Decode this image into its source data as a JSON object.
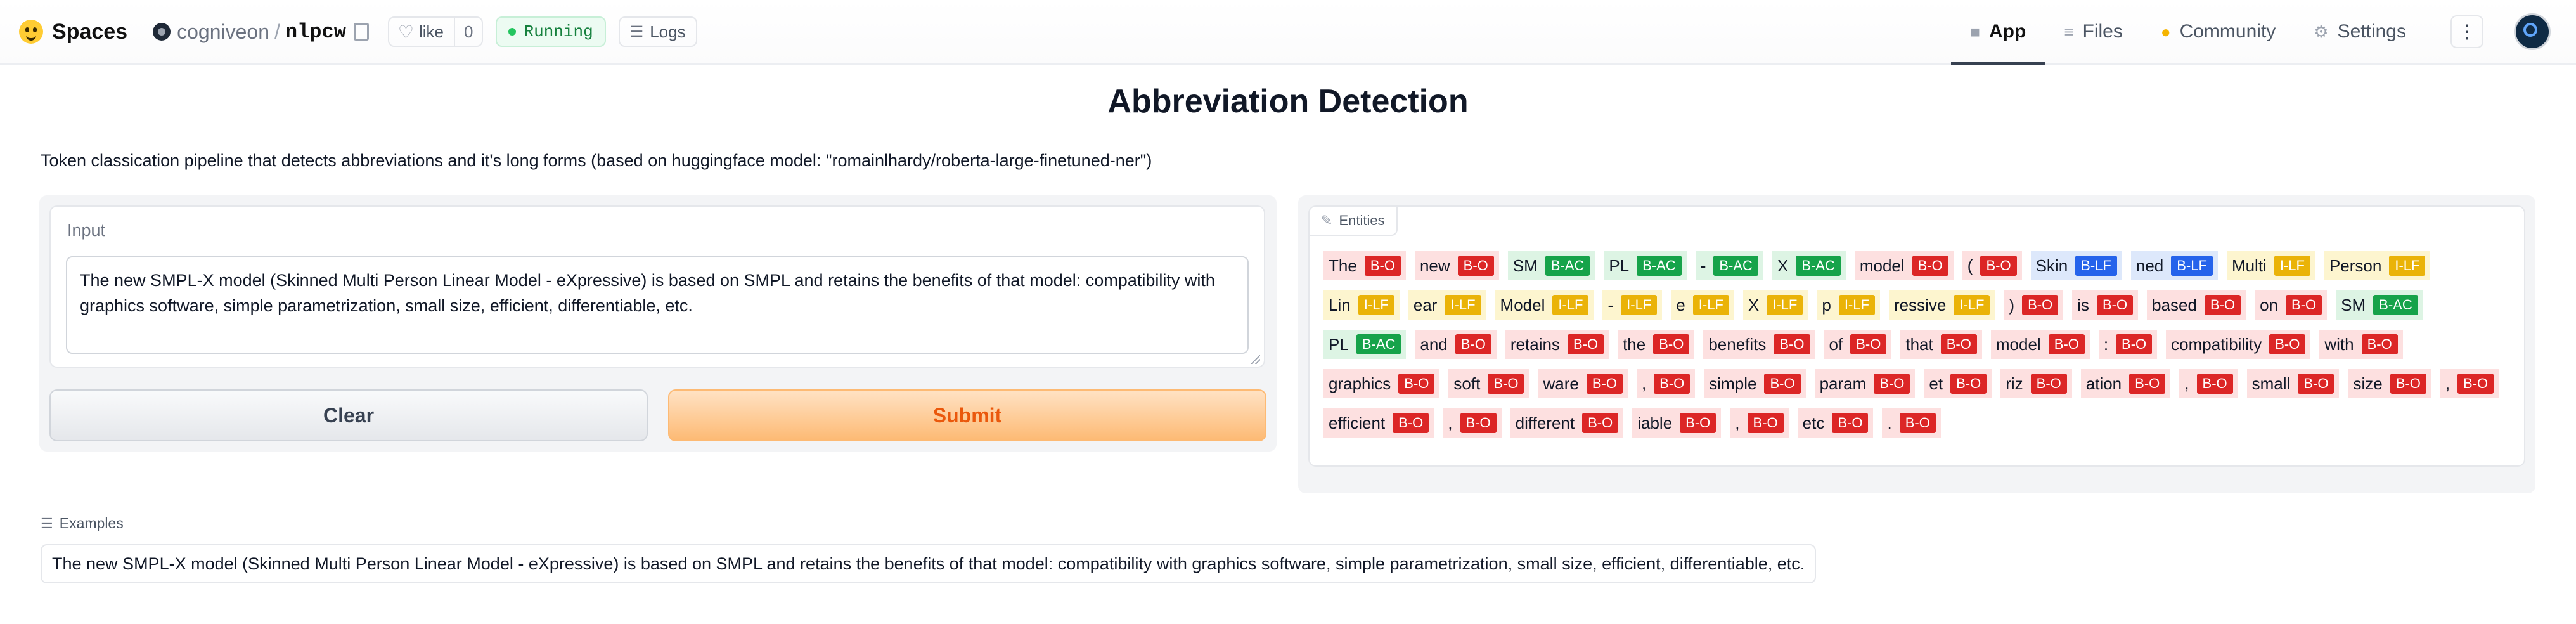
{
  "header": {
    "brand": "Spaces",
    "owner": "cogniveon",
    "separator": "/",
    "repo": "nlpcw",
    "like_label": "like",
    "like_count": "0",
    "status": "Running",
    "logs_label": "Logs",
    "tabs": [
      {
        "label": "App",
        "icon": "app-cube-icon",
        "active": true
      },
      {
        "label": "Files",
        "icon": "files-icon",
        "active": false
      },
      {
        "label": "Community",
        "icon": "community-chat-icon",
        "active": false
      },
      {
        "label": "Settings",
        "icon": "settings-gear-icon",
        "active": false
      }
    ],
    "more_icon": "vertical-dots-icon"
  },
  "main": {
    "title": "Abbreviation Detection",
    "description": "Token classication pipeline that detects abbreviations and it's long forms (based on huggingface model: \"romainlhardy/roberta-large-finetuned-ner\")",
    "input_label": "Input",
    "input_value": "The new SMPL-X model (Skinned Multi Person Linear Model - eXpressive) is based on SMPL and retains the benefits of that model: compatibility with graphics software, simple parametrization, small size, efficient, differentiable, etc.",
    "clear_label": "Clear",
    "submit_label": "Submit",
    "entities_label": "Entities",
    "examples_label": "Examples",
    "example_1": "The new SMPL-X model (Skinned Multi Person Linear Model - eXpressive) is based on SMPL and retains the benefits of that model: compatibility with graphics software, simple parametrization, small size, efficient, differentiable, etc."
  },
  "entity_colors": {
    "B-O": "#dc2626",
    "B-AC": "#16a34a",
    "B-LF": "#2563eb",
    "I-LF": "#eab308"
  },
  "tokens": [
    {
      "text": "The",
      "tag": "B-O"
    },
    {
      "text": "new",
      "tag": "B-O"
    },
    {
      "text": "SM",
      "tag": "B-AC"
    },
    {
      "text": "PL",
      "tag": "B-AC"
    },
    {
      "text": "-",
      "tag": "B-AC"
    },
    {
      "text": "X",
      "tag": "B-AC"
    },
    {
      "text": "model",
      "tag": "B-O"
    },
    {
      "text": "(",
      "tag": "B-O"
    },
    {
      "text": "Skin",
      "tag": "B-LF"
    },
    {
      "text": "ned",
      "tag": "B-LF"
    },
    {
      "text": "Multi",
      "tag": "I-LF"
    },
    {
      "text": "Person",
      "tag": "I-LF"
    },
    {
      "text": "Lin",
      "tag": "I-LF"
    },
    {
      "text": "ear",
      "tag": "I-LF"
    },
    {
      "text": "Model",
      "tag": "I-LF"
    },
    {
      "text": "-",
      "tag": "I-LF"
    },
    {
      "text": "e",
      "tag": "I-LF"
    },
    {
      "text": "X",
      "tag": "I-LF"
    },
    {
      "text": "p",
      "tag": "I-LF"
    },
    {
      "text": "ressive",
      "tag": "I-LF"
    },
    {
      "text": ")",
      "tag": "B-O"
    },
    {
      "text": "is",
      "tag": "B-O"
    },
    {
      "text": "based",
      "tag": "B-O"
    },
    {
      "text": "on",
      "tag": "B-O"
    },
    {
      "text": "SM",
      "tag": "B-AC"
    },
    {
      "text": "PL",
      "tag": "B-AC"
    },
    {
      "text": "and",
      "tag": "B-O"
    },
    {
      "text": "retains",
      "tag": "B-O"
    },
    {
      "text": "the",
      "tag": "B-O"
    },
    {
      "text": "benefits",
      "tag": "B-O"
    },
    {
      "text": "of",
      "tag": "B-O"
    },
    {
      "text": "that",
      "tag": "B-O"
    },
    {
      "text": "model",
      "tag": "B-O"
    },
    {
      "text": ":",
      "tag": "B-O"
    },
    {
      "text": "compatibility",
      "tag": "B-O"
    },
    {
      "text": "with",
      "tag": "B-O"
    },
    {
      "text": "graphics",
      "tag": "B-O"
    },
    {
      "text": "soft",
      "tag": "B-O"
    },
    {
      "text": "ware",
      "tag": "B-O"
    },
    {
      "text": ",",
      "tag": "B-O"
    },
    {
      "text": "simple",
      "tag": "B-O"
    },
    {
      "text": "param",
      "tag": "B-O"
    },
    {
      "text": "et",
      "tag": "B-O"
    },
    {
      "text": "riz",
      "tag": "B-O"
    },
    {
      "text": "ation",
      "tag": "B-O"
    },
    {
      "text": ",",
      "tag": "B-O"
    },
    {
      "text": "small",
      "tag": "B-O"
    },
    {
      "text": "size",
      "tag": "B-O"
    },
    {
      "text": ",",
      "tag": "B-O"
    },
    {
      "text": "efficient",
      "tag": "B-O"
    },
    {
      "text": ",",
      "tag": "B-O"
    },
    {
      "text": "different",
      "tag": "B-O"
    },
    {
      "text": "iable",
      "tag": "B-O"
    },
    {
      "text": ",",
      "tag": "B-O"
    },
    {
      "text": "etc",
      "tag": "B-O"
    },
    {
      "text": ".",
      "tag": "B-O"
    }
  ]
}
